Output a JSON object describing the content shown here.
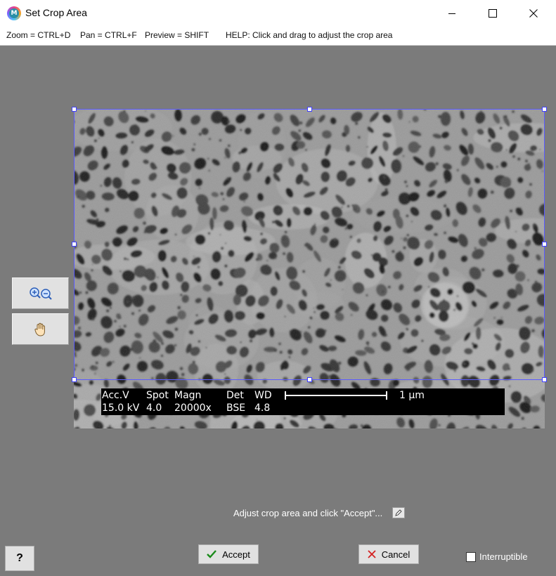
{
  "window": {
    "title": "Set Crop Area",
    "app_icon_letter": "M"
  },
  "helpbar": {
    "zoom": "Zoom = CTRL+D",
    "pan": "Pan = CTRL+F",
    "preview": "Preview = SHIFT",
    "help": "HELP:  Click and drag to adjust the crop area"
  },
  "tools": {
    "zoom_icon": "zoom-in-out-icon",
    "pan_icon": "hand-pan-icon"
  },
  "databar": {
    "row1": [
      "Acc.V",
      "Spot",
      "Magn",
      "Det",
      "WD"
    ],
    "row2": [
      "15.0 kV",
      "4.0",
      "20000x",
      "BSE",
      "4.8"
    ],
    "scale_label": "1 µm"
  },
  "status": {
    "text": "Adjust crop area and click \"Accept\"..."
  },
  "buttons": {
    "help": "?",
    "accept": "Accept",
    "cancel": "Cancel"
  },
  "interruptible": {
    "label": "Interruptible",
    "checked": false
  },
  "colors": {
    "workspace": "#7b7b7b",
    "crop_border": "#5b5bff",
    "accept_check": "#1a8a1a",
    "cancel_x": "#d42020"
  }
}
